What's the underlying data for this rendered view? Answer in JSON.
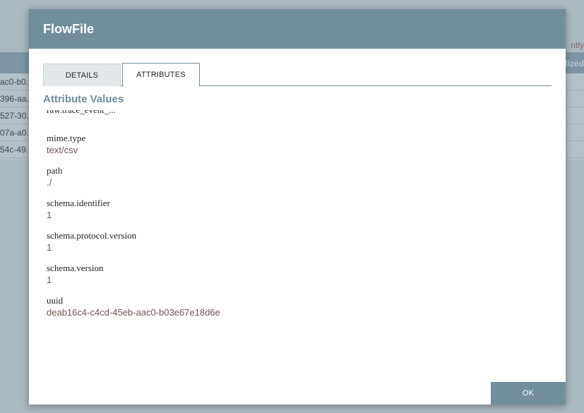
{
  "background": {
    "right_text_1": "ntly",
    "right_text_2": "lized",
    "rows": [
      "ac0-b0...",
      "396-aa...",
      "527-30...",
      "07a-a0...",
      "54c-49..."
    ]
  },
  "modal": {
    "title": "FlowFile",
    "tabs": [
      {
        "label": "DETAILS",
        "active": false
      },
      {
        "label": "ATTRIBUTES",
        "active": true
      }
    ],
    "section_title": "Attribute Values",
    "cut_attribute": "raw.trace_event_...",
    "attributes": [
      {
        "name": "mime.type",
        "value": "text/csv"
      },
      {
        "name": "path",
        "value": "./"
      },
      {
        "name": "schema.identifier",
        "value": "1"
      },
      {
        "name": "schema.protocol.version",
        "value": "1"
      },
      {
        "name": "schema.version",
        "value": "1"
      },
      {
        "name": "uuid",
        "value": "deab16c4-c4cd-45eb-aac0-b03e67e18d6e"
      }
    ],
    "ok_label": "OK"
  },
  "colors": {
    "header": "#728e9b",
    "value": "#775351",
    "overlay": "#aab8c0"
  }
}
